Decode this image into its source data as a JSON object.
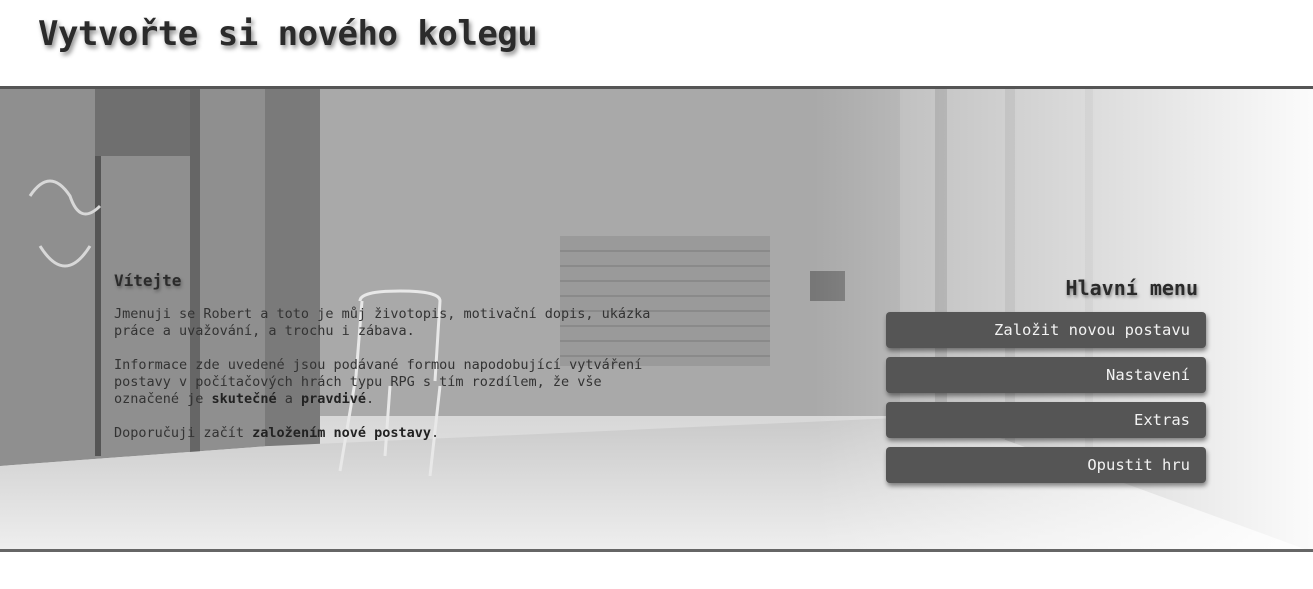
{
  "header": {
    "title": "Vytvořte si nového kolegu"
  },
  "intro": {
    "heading": "Vítejte",
    "p1": "Jmenuji se Robert a toto je můj životopis, motivační dopis, ukázka práce a uvažování, a trochu i zábava.",
    "p2_before": "Informace zde uvedené jsou podávané formou napodobující vytváření postavy v počítačových hrách typu RPG s tím rozdílem, že vše označené je ",
    "p2_bold1": "skutečné",
    "p2_mid": " a ",
    "p2_bold2": "pravdivé",
    "p2_after": ".",
    "p3_before": "Doporučuji začít ",
    "p3_bold": "založením nové postavy",
    "p3_after": "."
  },
  "menu": {
    "title": "Hlavní menu",
    "buttons": [
      {
        "label": "Založit novou postavu"
      },
      {
        "label": "Nastavení"
      },
      {
        "label": "Extras"
      },
      {
        "label": "Opustit hru"
      }
    ]
  },
  "colors": {
    "button_bg": "#555555",
    "button_text": "#f2f2f2",
    "title_text": "#2b2b2b"
  }
}
